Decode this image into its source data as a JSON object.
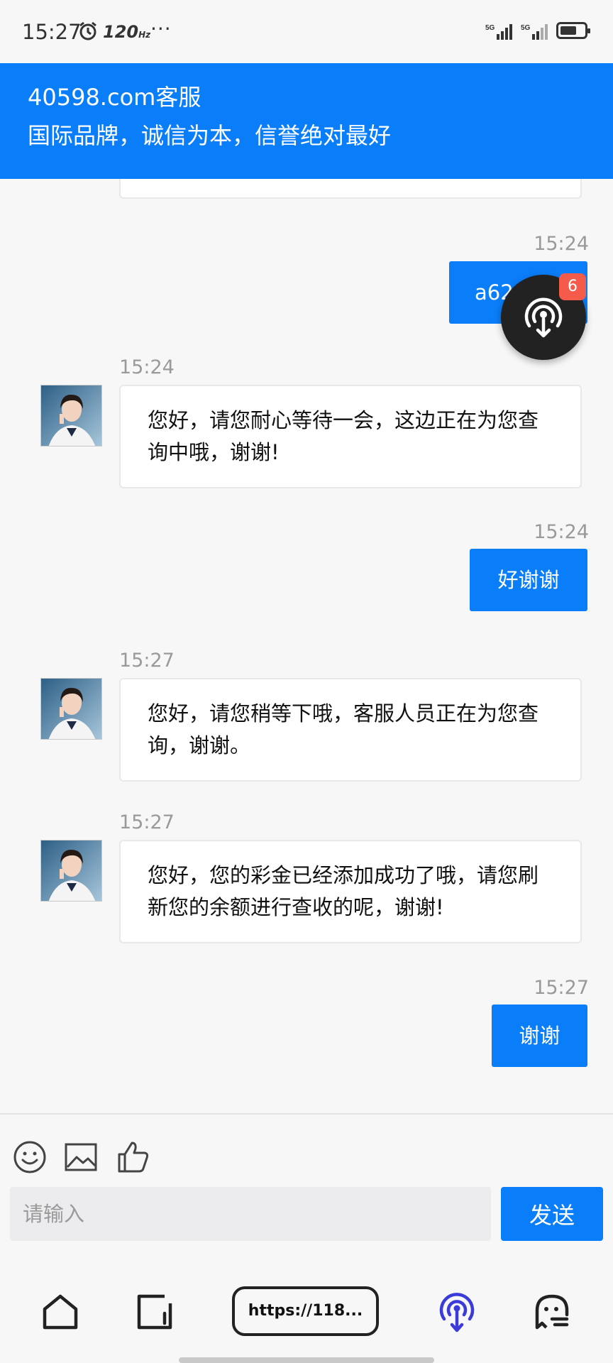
{
  "status_bar": {
    "time": "15:27",
    "refresh_rate": "120",
    "refresh_unit": "Hz",
    "more": "···",
    "network_1": "5G",
    "network_2": "5G"
  },
  "header": {
    "title": "40598.com客服",
    "subtitle": "国际品牌，诚信为本，信誉绝对最好"
  },
  "messages": [
    {
      "direction": "out",
      "time": "15:24",
      "text": "a62"
    },
    {
      "direction": "in",
      "time": "15:24",
      "text": "您好，请您耐心等待一会，这边正在为您查询中哦，谢谢!"
    },
    {
      "direction": "out",
      "time": "15:24",
      "text": "好谢谢"
    },
    {
      "direction": "in",
      "time": "15:27",
      "text": "您好，请您稍等下哦，客服人员正在为您查询，谢谢。"
    },
    {
      "direction": "in",
      "time": "15:27",
      "text": "您好，您的彩金已经添加成功了哦，请您刷新您的余额进行查收的呢，谢谢!"
    },
    {
      "direction": "out",
      "time": "15:27",
      "text": "谢谢"
    }
  ],
  "floating_button": {
    "icon": "podcast-touch-icon",
    "badge": "6"
  },
  "composer": {
    "tools": [
      "emoji-icon",
      "image-icon",
      "thumbs-up-icon"
    ],
    "placeholder": "请输入",
    "send_label": "发送"
  },
  "browser_nav": {
    "url": "https://118...",
    "items": [
      "home-icon",
      "tabs-icon",
      "url-pill",
      "podcast-icon",
      "ghost-icon"
    ]
  },
  "colors": {
    "accent": "#0a7df8",
    "badge": "#f55b4b",
    "fab": "#222222"
  }
}
